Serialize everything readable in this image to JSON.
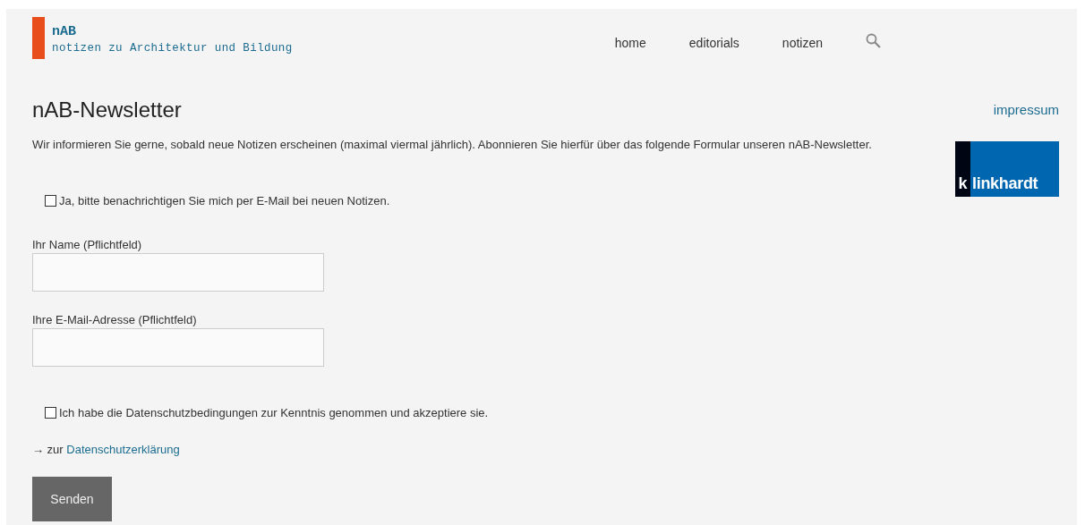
{
  "site": {
    "name": "nAB",
    "tagline": "notizen zu Architektur und Bildung"
  },
  "nav": {
    "items": [
      {
        "label": "home"
      },
      {
        "label": "editorials"
      },
      {
        "label": "notizen"
      }
    ]
  },
  "page": {
    "title": "nAB-Newsletter",
    "intro": "Wir informieren Sie gerne, sobald neue Notizen erscheinen (maximal viermal jährlich). Abonnieren Sie hierfür über das folgende Formular unseren nAB-Newsletter."
  },
  "form": {
    "subscribe": {
      "label": "Ja, bitte benachrichtigen Sie mich per E-Mail bei neuen Notizen.",
      "checked": false
    },
    "fields": [
      {
        "label": "Ihr Name (Pflichtfeld)"
      },
      {
        "label": "Ihre E-Mail-Adresse (Pflichtfeld)"
      }
    ],
    "consent": {
      "label": "Ich habe die Datenschutzbedingungen zur Kenntnis genommen und akzeptiere sie.",
      "checked": false
    },
    "privacy": {
      "prefix": "→ zur",
      "link": "Datenschutzerklärung"
    },
    "submit": "Senden"
  },
  "sidebar": {
    "link": "impressum",
    "logo": {
      "letter": "k",
      "text": "linkhardt"
    }
  }
}
